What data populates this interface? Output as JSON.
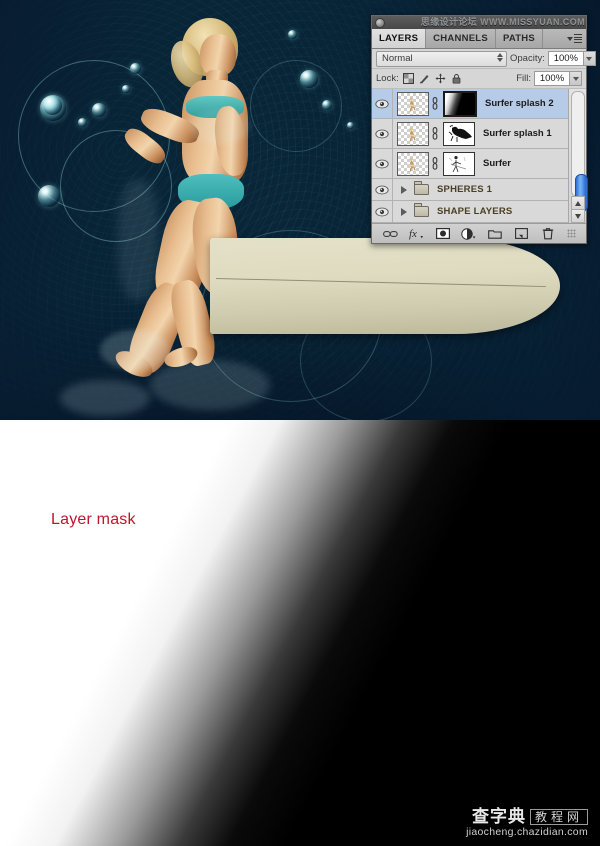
{
  "artwork": {
    "description": "surfer-woman-with-surfboard-underwater-teal-composite",
    "alt": "Surfer composite artwork",
    "colors": {
      "teal": "#16a8ad",
      "deep_blue": "#082638",
      "board": "#ded9bd",
      "skin": "#e0b183"
    }
  },
  "panel": {
    "titlebar": {
      "watermark": "思缘设计论坛 WWW.MISSYUAN.COM",
      "collapse_icon": "collapse-dot"
    },
    "tabs": [
      {
        "label": "LAYERS",
        "active": true
      },
      {
        "label": "CHANNELS",
        "active": false
      },
      {
        "label": "PATHS",
        "active": false
      }
    ],
    "menu_icon": "panel-menu-icon",
    "blend": {
      "value": "Normal",
      "opacity_label": "Opacity:",
      "opacity_value": "100%"
    },
    "lock": {
      "label": "Lock:",
      "icons": [
        "lock-transparent-icon",
        "lock-image-icon",
        "lock-position-icon",
        "lock-all-icon"
      ],
      "fill_label": "Fill:",
      "fill_value": "100%"
    },
    "layers": [
      {
        "name": "Surfer splash 2",
        "visible": true,
        "selected": true,
        "thumb": "surfer-figure-thumb",
        "link_icon": "link-chain-icon",
        "mask": "gradient-black-white-mask",
        "mask_active": true,
        "type": "layer"
      },
      {
        "name": "Surfer splash 1",
        "visible": true,
        "selected": false,
        "thumb": "surfer-figure-thumb",
        "link_icon": "link-chain-icon",
        "mask": "black-blob-mask",
        "mask_active": false,
        "type": "layer"
      },
      {
        "name": "Surfer",
        "visible": true,
        "selected": false,
        "thumb": "surfer-figure-thumb",
        "link_icon": "link-chain-icon",
        "mask": "thin-outline-mask",
        "mask_active": false,
        "type": "layer"
      },
      {
        "name": "SPHERES 1",
        "visible": true,
        "selected": false,
        "type": "group",
        "expanded": false
      },
      {
        "name": "SHAPE LAYERS",
        "visible": true,
        "selected": false,
        "type": "group",
        "expanded": false
      }
    ],
    "footer_buttons": [
      "link-layers-icon",
      "layer-style-fx-icon",
      "add-layer-mask-icon",
      "new-adjustment-layer-icon",
      "new-group-icon",
      "new-layer-icon",
      "delete-layer-icon"
    ],
    "scrollbar": {
      "thumb_color": "#3a7bd5"
    }
  },
  "mask_image": {
    "label": "Layer mask",
    "label_color": "#c0142c",
    "gradient": "white-to-black-diagonal"
  },
  "bottom_watermark": {
    "brand": "查字典",
    "boxed": "教程网",
    "url": "jiaocheng.chazidian.com"
  }
}
